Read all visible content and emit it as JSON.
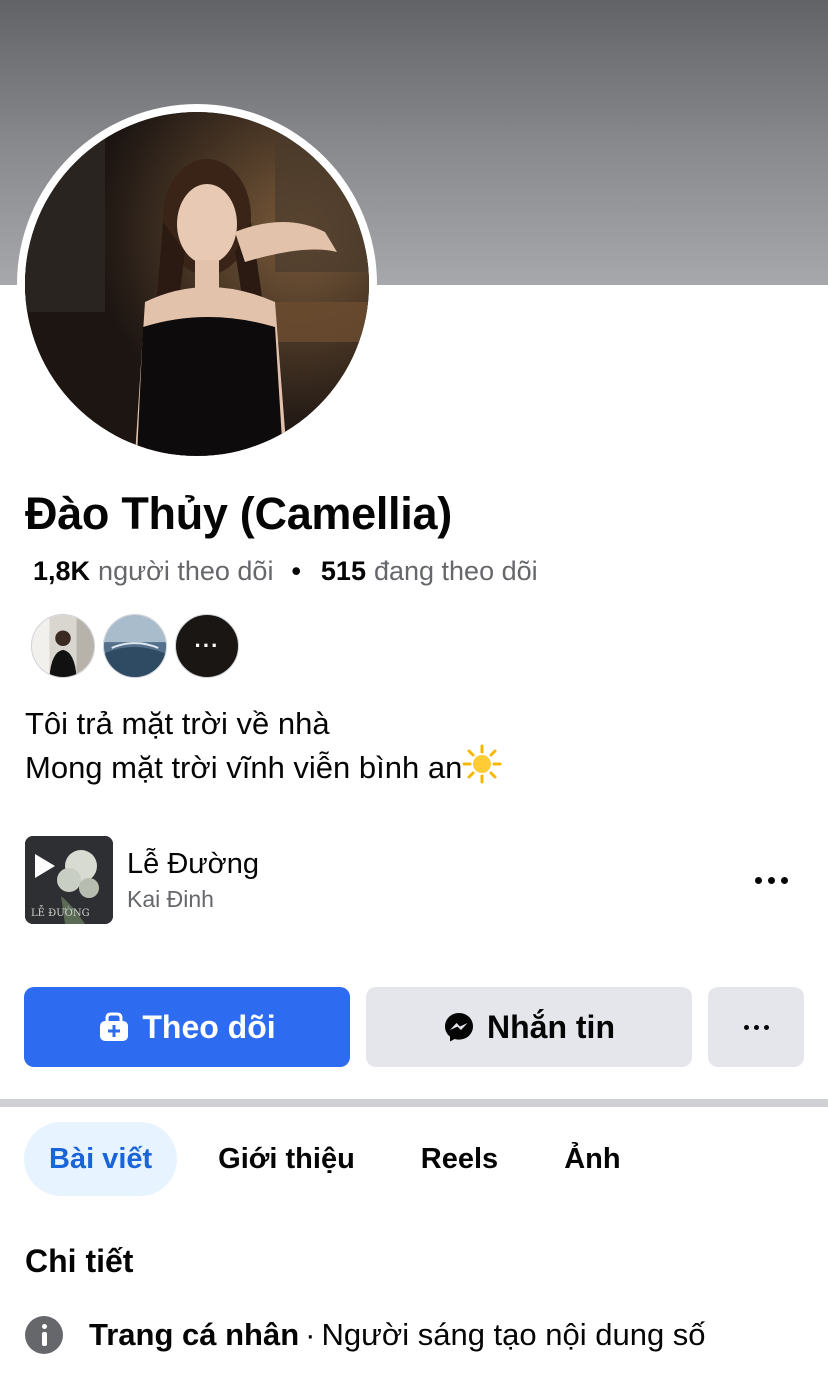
{
  "profile": {
    "name": "Đào Thủy (Camellia)",
    "followers_count": "1,8K",
    "followers_label": "người theo dõi",
    "separator": "•",
    "following_count": "515",
    "following_label": "đang theo dõi",
    "mutual_more": "···",
    "bio_line1": "Tôi trả mặt trời về nhà",
    "bio_line2": "Mong mặt trời vĩnh viễn bình an"
  },
  "music": {
    "song": "Lễ Đường",
    "artist": "Kai Đinh"
  },
  "actions": {
    "follow_label": "Theo dõi",
    "message_label": "Nhắn tin"
  },
  "tabs": [
    {
      "label": "Bài viết",
      "active": true
    },
    {
      "label": "Giới thiệu",
      "active": false
    },
    {
      "label": "Reels",
      "active": false
    },
    {
      "label": "Ảnh",
      "active": false
    }
  ],
  "details": {
    "title": "Chi tiết",
    "page_type": "Trang cá nhân",
    "separator": "·",
    "category": "Người sáng tạo nội dung số"
  },
  "colors": {
    "primary": "#2d6cf0",
    "active_tab_bg": "#e7f3ff",
    "active_tab_text": "#1b64d8",
    "secondary_text": "#65676b",
    "button_gray": "#e4e6eb"
  }
}
